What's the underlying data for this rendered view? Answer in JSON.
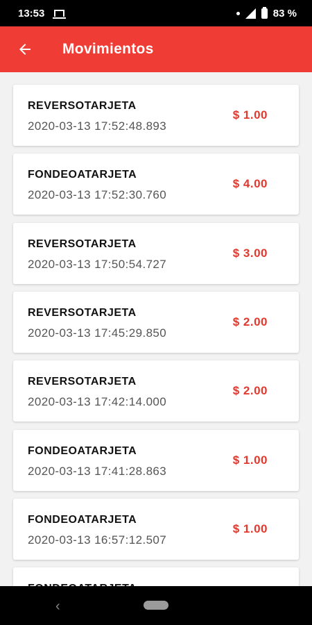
{
  "status_bar": {
    "time": "13:53",
    "battery": "83 %"
  },
  "app_bar": {
    "title": "Movimientos"
  },
  "movements": [
    {
      "type": "REVERSOTARJETA",
      "date": "2020-03-13 17:52:48.893",
      "amount": "$ 1.00"
    },
    {
      "type": "FONDEOATARJETA",
      "date": "2020-03-13 17:52:30.760",
      "amount": "$ 4.00"
    },
    {
      "type": "REVERSOTARJETA",
      "date": "2020-03-13 17:50:54.727",
      "amount": "$ 3.00"
    },
    {
      "type": "REVERSOTARJETA",
      "date": "2020-03-13 17:45:29.850",
      "amount": "$ 2.00"
    },
    {
      "type": "REVERSOTARJETA",
      "date": "2020-03-13 17:42:14.000",
      "amount": "$ 2.00"
    },
    {
      "type": "FONDEOATARJETA",
      "date": "2020-03-13 17:41:28.863",
      "amount": "$ 1.00"
    },
    {
      "type": "FONDEOATARJETA",
      "date": "2020-03-13 16:57:12.507",
      "amount": "$ 1.00"
    },
    {
      "type": "FONDEOATARJETA",
      "date": "",
      "amount": ""
    }
  ],
  "colors": {
    "header": "#ef3d35",
    "amount": "#e03a30"
  }
}
